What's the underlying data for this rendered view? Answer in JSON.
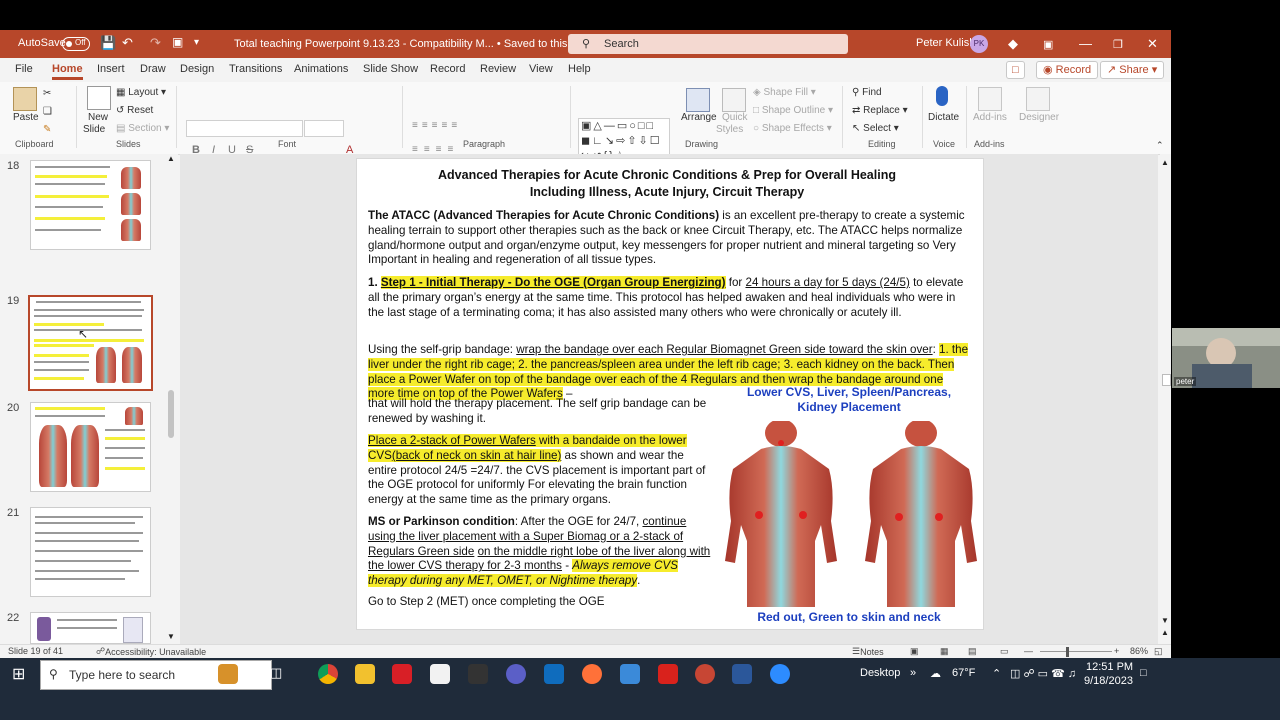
{
  "titlebar": {
    "autosave_label": "AutoSave",
    "autosave_state": "Off",
    "doc_title": "Total teaching Powerpoint 9.13.23  -  Compatibility M...  •  Saved to this PC ⌄",
    "search_placeholder": "Search",
    "user_name": "Peter Kulish",
    "user_initials": "PK"
  },
  "menu": {
    "items": [
      "File",
      "Home",
      "Insert",
      "Draw",
      "Design",
      "Transitions",
      "Animations",
      "Slide Show",
      "Record",
      "Review",
      "View",
      "Help"
    ],
    "active": "Home",
    "record_button": "Record",
    "share_button": "Share"
  },
  "ribbon": {
    "clipboard": {
      "paste": "Paste",
      "group": "Clipboard"
    },
    "slides": {
      "new_slide": "New",
      "new_slide2": "Slide",
      "layout": "Layout",
      "reset": "Reset",
      "section": "Section",
      "group": "Slides"
    },
    "font": {
      "group": "Font",
      "bold": "B",
      "italic": "I",
      "underline": "U",
      "strike": "S",
      "font_color": "A"
    },
    "paragraph": {
      "group": "Paragraph"
    },
    "drawing": {
      "arrange": "Arrange",
      "quick_styles": "Quick",
      "quick_styles2": "Styles",
      "shape_fill": "Shape Fill",
      "shape_outline": "Shape Outline",
      "shape_effects": "Shape Effects",
      "group": "Drawing"
    },
    "editing": {
      "find": "Find",
      "replace": "Replace",
      "select": "Select",
      "group": "Editing"
    },
    "voice": {
      "dictate": "Dictate",
      "group": "Voice"
    },
    "addins": {
      "addins": "Add-ins",
      "designer": "Designer",
      "group": "Add-ins"
    }
  },
  "thumbnails": [
    {
      "number": "18",
      "selected": false
    },
    {
      "number": "19",
      "selected": true
    },
    {
      "number": "20",
      "selected": false
    },
    {
      "number": "21",
      "selected": false
    },
    {
      "number": "22",
      "selected": false
    }
  ],
  "slide": {
    "title_line1": "Advanced Therapies for  Acute Chronic Conditions & Prep for Overall Healing",
    "title_line2": "Including Illness, Acute Injury, Circuit Therapy",
    "p1_bold": "The ATACC (Advanced Therapies for Acute Chronic Conditions)",
    "p1_rest": " is an excellent pre-therapy to create a systemic healing terrain to support other therapies such as the back or knee Circuit Therapy, etc. The ATACC helps normalize gland/hormone output and organ/enzyme output, key messengers for proper nutrient and mineral targeting so Very Important in healing  and regeneration of all tissue types.",
    "p2_num": "1. ",
    "p2_hl": "Step 1 - Initial Therapy - Do the OGE (Organ Group Energizing)",
    "p2_mid": " for ",
    "p2_u": "24 hours a day for 5 days (24/5)",
    "p2_rest": " to elevate all the primary organ’s energy at the same time. This protocol has helped awaken and heal individuals who were in the last stage of a terminating coma; it has also assisted many others who were chronically  or acutely ill.",
    "p3_a": "Using the self-grip bandage: ",
    "p3_u": "wrap the bandage over each Regular Biomagnet Green side toward the skin over",
    "p3_b": ":",
    "p3_hl": "1. the liver under the right rib cage; 2. the pancreas/spleen area under the left rib cage; 3. each kidney on the back. Then place a Power Wafer on top of the bandage over each of the 4 Regulars and then wrap the bandage around one more time on top of the Power Wafers",
    "p3_tail1": " –",
    "p3_tail2": "that will hold the therapy placement. The self grip bandage can be renewed by washing it.",
    "p4_hlu": "Place a 2-stack of Power Wafers",
    "p4_hl": " with a bandaide on the lower CVS",
    "p4_hlu2": "(back of neck on skin at hair line)",
    "p4_rest": " as shown and wear the entire protocol 24/5 =24/7. the CVS placement is important part of the OGE protocol for uniformly For elevating the brain function energy at the same time as the primary organs.",
    "p5_bold": "MS or Parkinson condition",
    "p5_a": ": After the OGE for 24/7, ",
    "p5_u1": "continue using the liver placement with a Super Biomag or a 2-stack of Regulars Green side",
    "p5_b": " ",
    "p5_u2": "on the middle right lobe of the liver along with the lower CVS therapy for 2-3 months",
    "p5_c": " - ",
    "p5_hli": "Always remove CVS therapy during any MET, OMET, or Nightime therapy",
    "p5_d": ".",
    "p6": "Go to Step 2 (MET) once completing the OGE",
    "caption_top": "Lower CVS, Liver, Spleen/Pancreas, Kidney Placement",
    "caption_bottom": "Red out, Green to skin and neck"
  },
  "status": {
    "slide_of": "Slide 19 of 41",
    "accessibility": "Accessibility: Unavailable",
    "notes": "Notes",
    "zoom": "86%"
  },
  "webcam": {
    "label": "peter"
  },
  "taskbar": {
    "search_placeholder": "Type here to search",
    "desktop": "Desktop",
    "weather": "67°F",
    "time": "12:51 PM",
    "date": "9/18/2023"
  },
  "colors": {
    "accent": "#b7472a",
    "highlight": "#f6ec2c",
    "caption_blue": "#1c3fbf",
    "taskbar": "#1f2b3a"
  }
}
